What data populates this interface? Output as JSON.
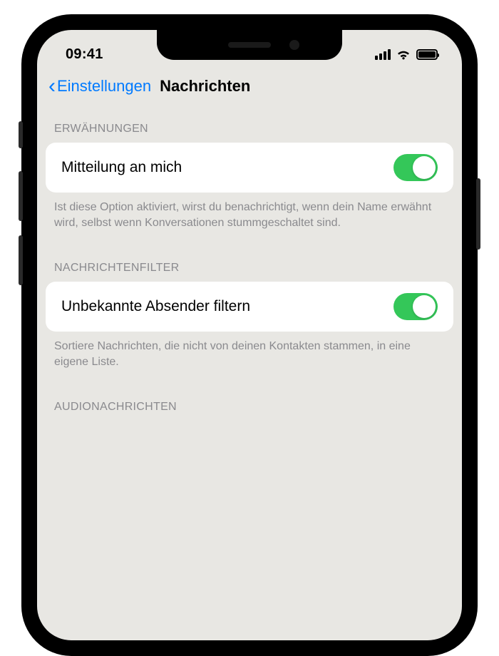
{
  "statusBar": {
    "time": "09:41"
  },
  "nav": {
    "back": "Einstellungen",
    "title": "Nachrichten"
  },
  "sections": {
    "mentions": {
      "header": "ERWÄHNUNGEN",
      "rowLabel": "Mitteilung an mich",
      "footer": "Ist diese Option aktiviert, wirst du benachrichtigt, wenn dein Name erwähnt wird, selbst wenn Konversationen stummgeschaltet sind."
    },
    "filter": {
      "header": "NACHRICHTENFILTER",
      "rowLabel": "Unbekannte Absender filtern",
      "footer": "Sortiere Nachrichten, die nicht von deinen Kontakten stammen, in eine eigene Liste."
    },
    "audio": {
      "header": "AUDIONACHRICHTEN"
    }
  }
}
